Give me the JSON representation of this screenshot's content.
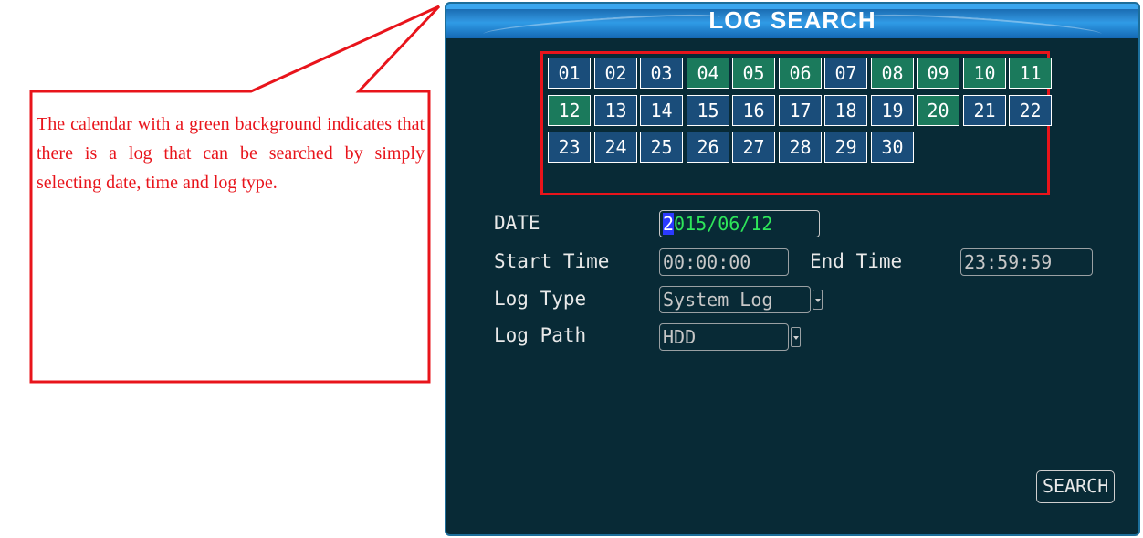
{
  "callout": {
    "text": "The calendar with a green background indicates that there is a log that can be searched by simply selecting date, time and log type."
  },
  "window": {
    "title": "LOG SEARCH"
  },
  "calendar": {
    "days": [
      {
        "label": "01",
        "has_log": false
      },
      {
        "label": "02",
        "has_log": false
      },
      {
        "label": "03",
        "has_log": false
      },
      {
        "label": "04",
        "has_log": true
      },
      {
        "label": "05",
        "has_log": true
      },
      {
        "label": "06",
        "has_log": true
      },
      {
        "label": "07",
        "has_log": false
      },
      {
        "label": "08",
        "has_log": true
      },
      {
        "label": "09",
        "has_log": true
      },
      {
        "label": "10",
        "has_log": true
      },
      {
        "label": "11",
        "has_log": true
      },
      {
        "label": "12",
        "has_log": true
      },
      {
        "label": "13",
        "has_log": false
      },
      {
        "label": "14",
        "has_log": false
      },
      {
        "label": "15",
        "has_log": false
      },
      {
        "label": "16",
        "has_log": false
      },
      {
        "label": "17",
        "has_log": false
      },
      {
        "label": "18",
        "has_log": false
      },
      {
        "label": "19",
        "has_log": false
      },
      {
        "label": "20",
        "has_log": true
      },
      {
        "label": "21",
        "has_log": false
      },
      {
        "label": "22",
        "has_log": false
      },
      {
        "label": "23",
        "has_log": false
      },
      {
        "label": "24",
        "has_log": false
      },
      {
        "label": "25",
        "has_log": false
      },
      {
        "label": "26",
        "has_log": false
      },
      {
        "label": "27",
        "has_log": false
      },
      {
        "label": "28",
        "has_log": false
      },
      {
        "label": "29",
        "has_log": false
      },
      {
        "label": "30",
        "has_log": false
      }
    ],
    "colors": {
      "has_log": "#1b7a5c",
      "no_log": "#1a4d7a"
    }
  },
  "form": {
    "date_label": "DATE",
    "date_cursor_char": "2",
    "date_rest": "015/06/12",
    "start_time_label": "Start Time",
    "start_time_value": "00:00:00",
    "end_time_label": "End Time",
    "end_time_value": "23:59:59",
    "log_type_label": "Log Type",
    "log_type_value": "System Log",
    "log_path_label": "Log Path",
    "log_path_value": "HDD"
  },
  "buttons": {
    "search": "SEARCH"
  }
}
